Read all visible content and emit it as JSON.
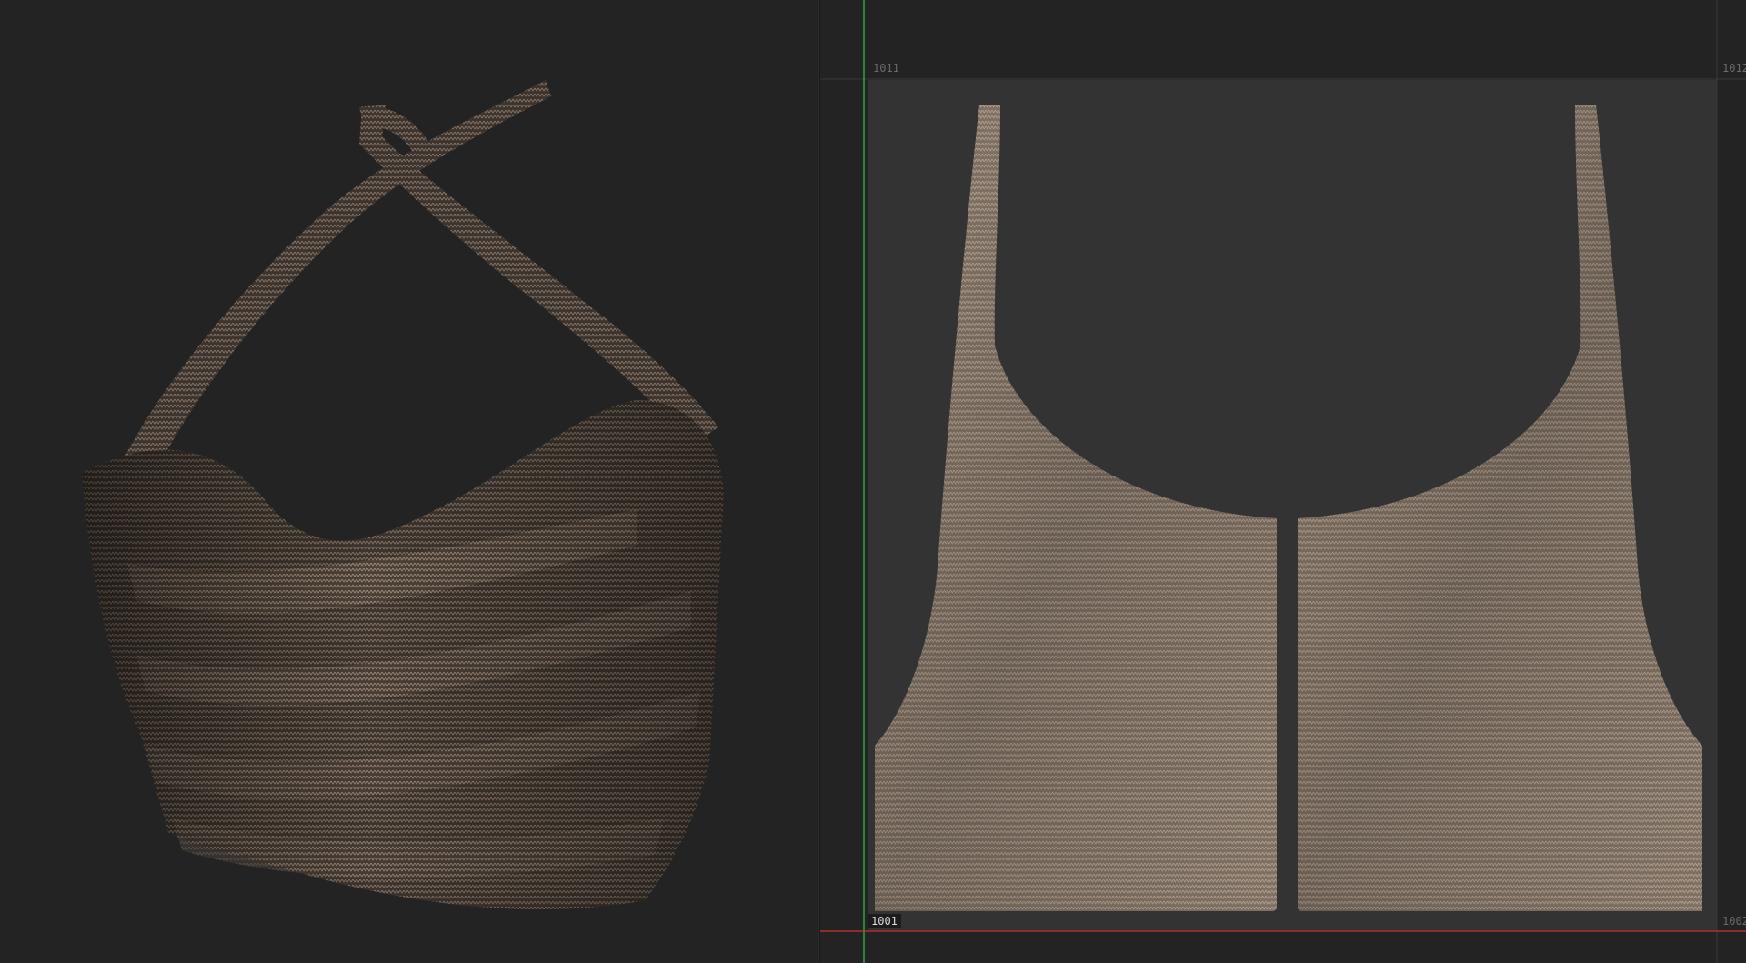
{
  "uv_editor": {
    "tiles": {
      "top_left": "1011",
      "top_right": "1012",
      "active": "1001",
      "bottom_right": "1002"
    }
  },
  "colors": {
    "background": "#232323",
    "uv_tile_fill": "#333333",
    "fabric_dark": "#3a322c",
    "fabric_light": "#a39282",
    "axis_u": "#c0392b",
    "axis_v": "#2ecc40"
  },
  "icons": {
    "garment_model": "halter-top-3d-mesh",
    "uv_shell_left": "uv-shell-front-left",
    "uv_shell_right": "uv-shell-front-right"
  }
}
